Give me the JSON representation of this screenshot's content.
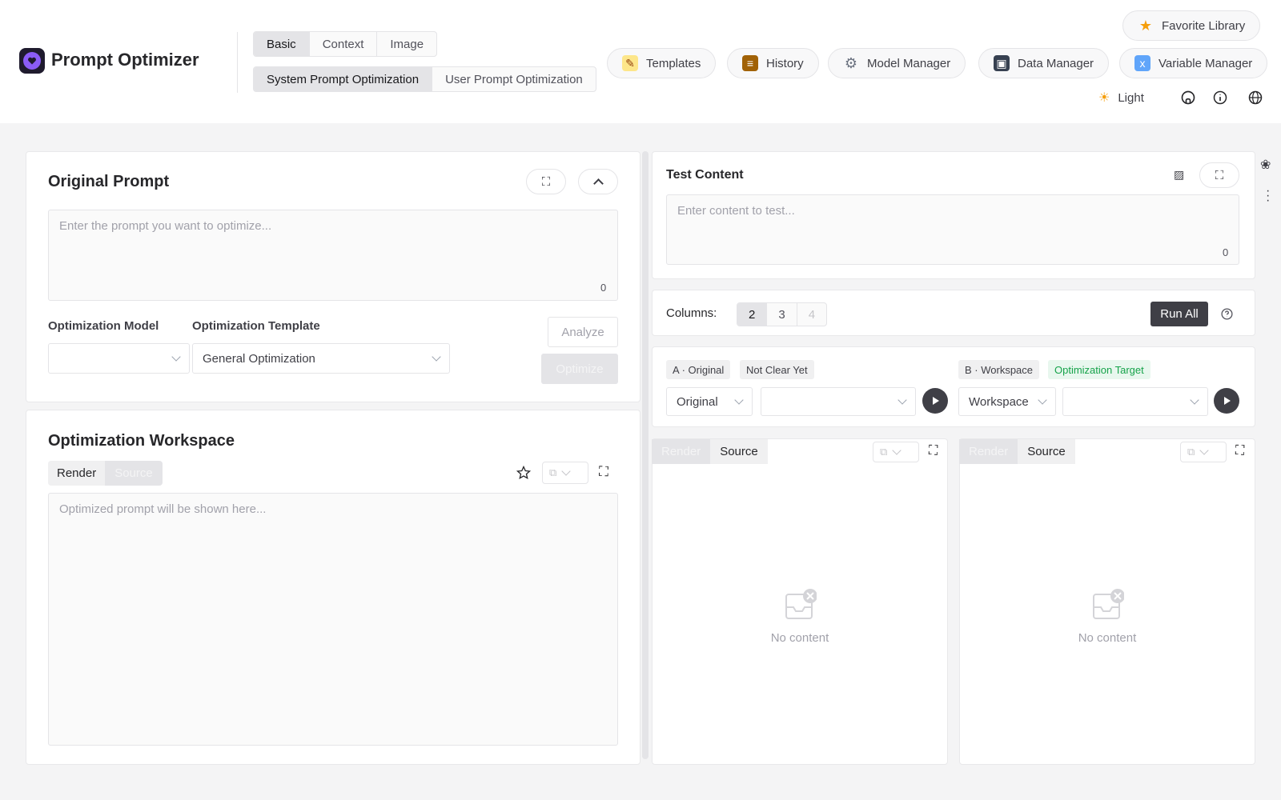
{
  "app": {
    "title": "Prompt Optimizer"
  },
  "modes": [
    "Basic",
    "Context",
    "Image"
  ],
  "submodes": [
    "System Prompt Optimization",
    "User Prompt Optimization"
  ],
  "nav": {
    "favorite": "Favorite Library",
    "templates": "Templates",
    "history": "History",
    "model_manager": "Model Manager",
    "data_manager": "Data Manager",
    "variable_manager": "Variable Manager",
    "theme": "Light"
  },
  "original": {
    "title": "Original Prompt",
    "placeholder": "Enter the prompt you want to optimize...",
    "count": "0",
    "model_label": "Optimization Model",
    "template_label": "Optimization Template",
    "template_value": "General Optimization",
    "analyze": "Analyze",
    "optimize": "Optimize"
  },
  "workspace": {
    "title": "Optimization Workspace",
    "render": "Render",
    "source": "Source",
    "placeholder": "Optimized prompt will be shown here..."
  },
  "test": {
    "title": "Test Content",
    "placeholder": "Enter content to test...",
    "count": "0",
    "columns_label": "Columns:",
    "columns": [
      "2",
      "3",
      "4"
    ],
    "run_all": "Run All"
  },
  "colA": {
    "tag": "A · Original",
    "status": "Not Clear Yet",
    "select": "Original",
    "render": "Render",
    "source": "Source",
    "empty": "No content"
  },
  "colB": {
    "tag": "B · Workspace",
    "status": "Optimization Target",
    "select": "Workspace",
    "render": "Render",
    "source": "Source",
    "empty": "No content"
  },
  "colors": {
    "accent": "#8b5cf6",
    "dark": "#3f3f46",
    "green": "#16a34a"
  }
}
